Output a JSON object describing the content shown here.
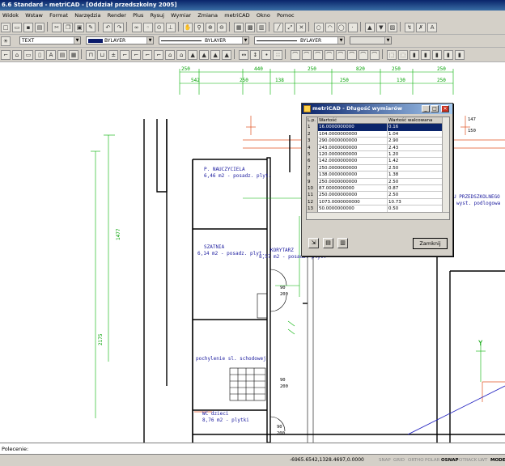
{
  "title": "6.6 Standard - metriCAD - [Oddział przedszkolny 2005]",
  "menu": [
    "Widok",
    "Wstaw",
    "Format",
    "Narzędzia",
    "Render",
    "Plus",
    "Rysuj",
    "Wymiar",
    "Zmiana",
    "metriCAD",
    "Okno",
    "Pomoc"
  ],
  "props": {
    "style": "TEXT",
    "color": "BYLAYER",
    "linetype": "BYLAYER",
    "lineweight": "BYLAYER"
  },
  "dims": {
    "top1": [
      "250",
      "440",
      "250",
      "820",
      "250",
      "250"
    ],
    "top2": [
      "542",
      "250",
      "138",
      "250",
      "130",
      "250"
    ],
    "left": "1477",
    "left2": "2175"
  },
  "rooms": [
    {
      "name": "P. NAUCZYCIELA",
      "desc": "6,46 m2 - posadz. plyt."
    },
    {
      "name": "SZATNIA",
      "desc": "6,14 m2 - posadz. plyt."
    },
    {
      "name": "KORYTARZ",
      "desc": "8,57 m2 - posadz. plyt."
    },
    {
      "name": "pochylenie sl. schodowej",
      "desc": ""
    },
    {
      "name": "WC dzieci",
      "desc": "8,76 m2 - plytki"
    },
    {
      "name": "U PRZEDSZKOLNEGO",
      "desc": "wyst. podlogowa"
    }
  ],
  "misc_labels": {
    "d1": "90",
    "d2": "200",
    "d3": "90",
    "d4": "200",
    "d5": "90",
    "d6": "200",
    "y": "Y",
    "w": "147",
    "h": "150"
  },
  "dialog": {
    "title": "metriCAD - Długość wymiarów",
    "columns": [
      "L.p.",
      "Wartość",
      "Wartość walcowana"
    ],
    "rows": [
      [
        "1",
        "16.0000000000",
        "0.16"
      ],
      [
        "2",
        "104.0000000000",
        "1.04"
      ],
      [
        "3",
        "290.0000000000",
        "2.90"
      ],
      [
        "4",
        "243.0000000000",
        "2.43"
      ],
      [
        "5",
        "120.0000000000",
        "1.20"
      ],
      [
        "6",
        "142.0000000000",
        "1.42"
      ],
      [
        "7",
        "250.0000000000",
        "2.50"
      ],
      [
        "8",
        "138.0000000000",
        "1.38"
      ],
      [
        "9",
        "250.0000000000",
        "2.50"
      ],
      [
        "10",
        "87.0000000000",
        "0.87"
      ],
      [
        "11",
        "250.0000000000",
        "2.50"
      ],
      [
        "12",
        "1073.0000000000",
        "10.73"
      ],
      [
        "13",
        "50.0000000000",
        "0.50"
      ]
    ],
    "close": "Zamknij"
  },
  "cmd": "Polecenie:",
  "status": {
    "coords": "-6965.6542,1328.4697,0.0000",
    "buttons": [
      "SNAP",
      "GRID",
      "ORTHO",
      "POLAR",
      "OSNAP",
      "OTRACK",
      "LWT",
      "MODEL"
    ],
    "on": [
      "OSNAP",
      "MODEL"
    ]
  }
}
